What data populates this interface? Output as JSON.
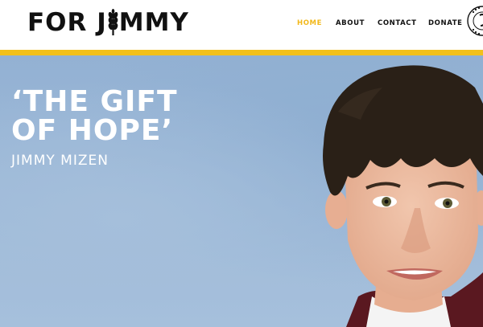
{
  "header": {
    "logo_part1": "FOR J",
    "logo_part2": "MMY",
    "logo_icon": "wheat-ear-icon",
    "seal_icon": "foundation-seal-icon",
    "nav": {
      "home": "HOME",
      "about": "ABOUT",
      "contact": "CONTACT",
      "donate": "DONATE"
    }
  },
  "hero": {
    "headline_line1": "‘THE GIFT",
    "headline_line2": "OF HOPE’",
    "subtitle": "JIMMY MIZEN",
    "image": "portrait-photo"
  },
  "colors": {
    "accent": "#f2c01b",
    "nav_active": "#f2b81b",
    "text_dark": "#111111",
    "hero_bg": "#9bb7d8"
  }
}
